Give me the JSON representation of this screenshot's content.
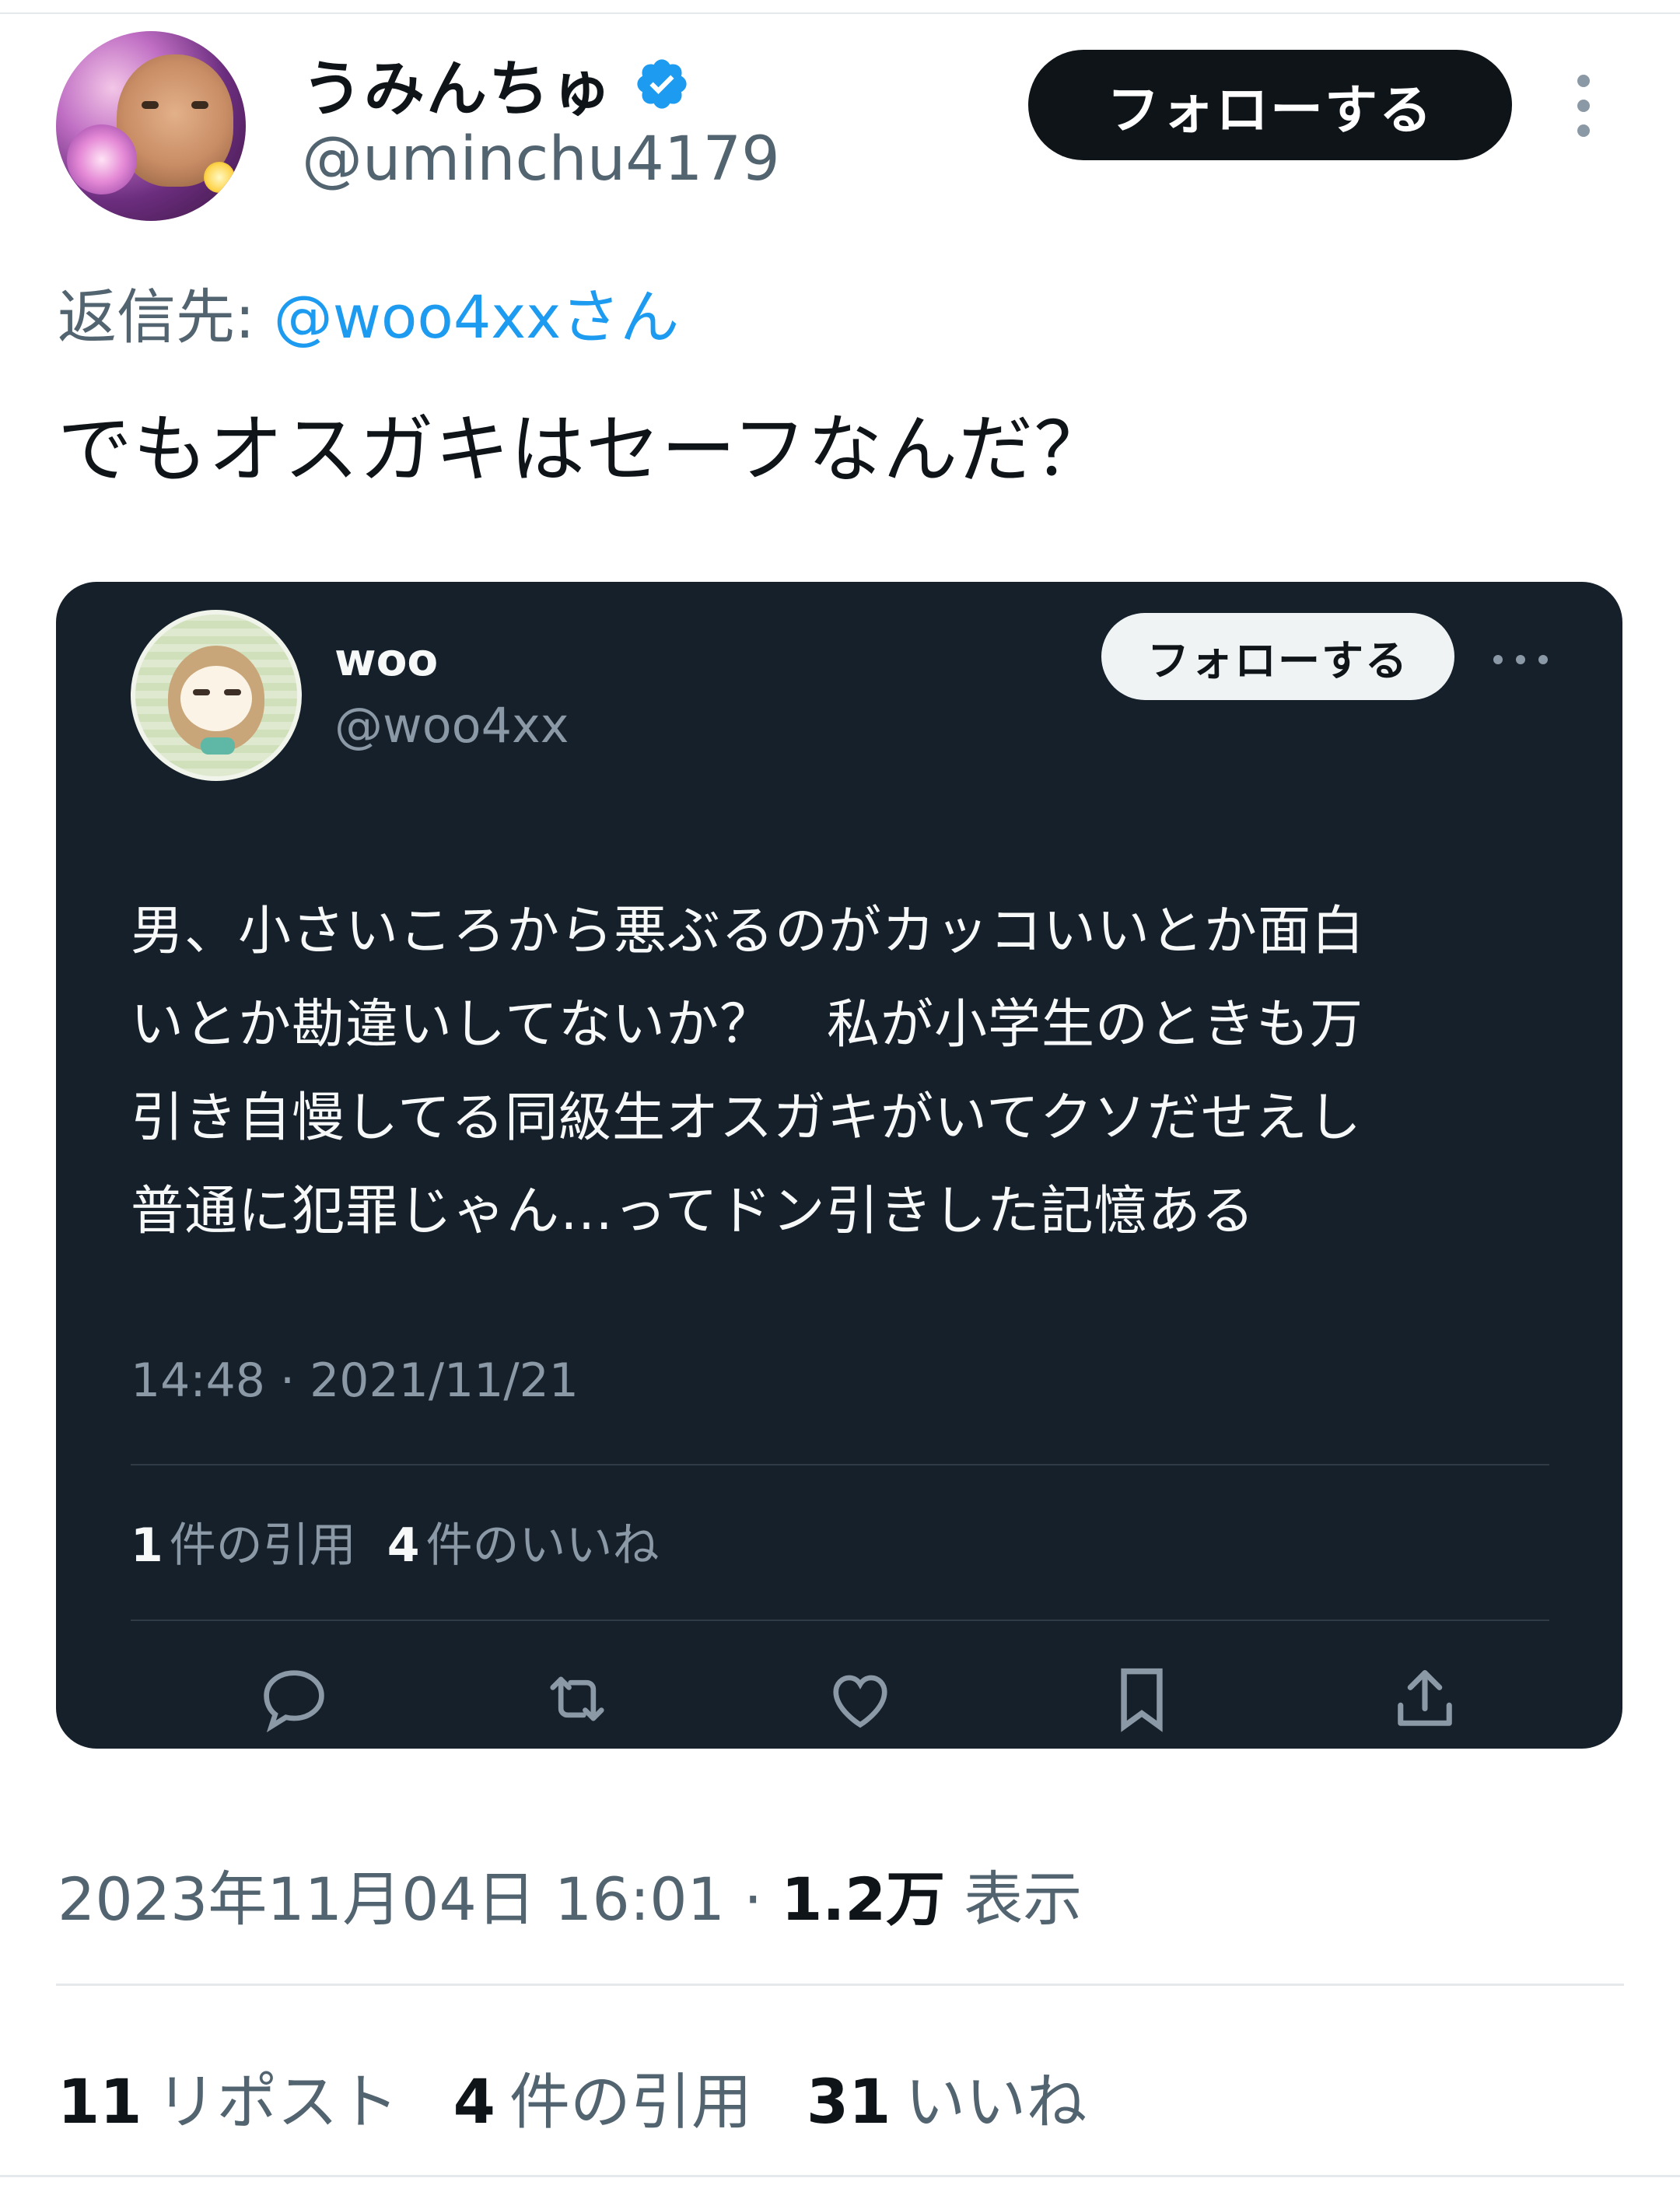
{
  "tweet": {
    "author": {
      "display_name": "うみんちゅ",
      "handle": "@uminchu4179",
      "verified": true,
      "verified_color": "#1d9bf0"
    },
    "follow_label": "フォローする",
    "reply_prefix": "返信先: ",
    "reply_mention": "@woo4xxさん",
    "text": "でもオスガキはセーフなんだ？",
    "timestamp": "2023年11月04日 16:01 · ",
    "views_count": "1.2万",
    "views_label": " 表示",
    "stats": {
      "reposts_count": "11",
      "reposts_label": "リポスト",
      "quotes_count": "4",
      "quotes_label": "件の引用",
      "likes_count": "31",
      "likes_label": "いいね"
    }
  },
  "quoted_tweet": {
    "author": {
      "display_name": "woo",
      "handle": "@woo4xx"
    },
    "follow_label": "フォローする",
    "text_lines": [
      "男、小さいころから悪ぶるのがカッコいいとか面白",
      "いとか勘違いしてないか？　私が小学生のときも万",
      "引き自慢してる同級生オスガキがいてクソだせえし",
      "普通に犯罪じゃん…ってドン引きした記憶ある"
    ],
    "timestamp": "14:48 · 2021/11/21",
    "stats": {
      "quotes_count": "1",
      "quotes_label": "件の引用",
      "likes_count": "4",
      "likes_label": "件のいいね"
    },
    "actions": [
      "reply-icon",
      "retweet-icon",
      "like-icon",
      "bookmark-icon",
      "share-icon"
    ]
  }
}
